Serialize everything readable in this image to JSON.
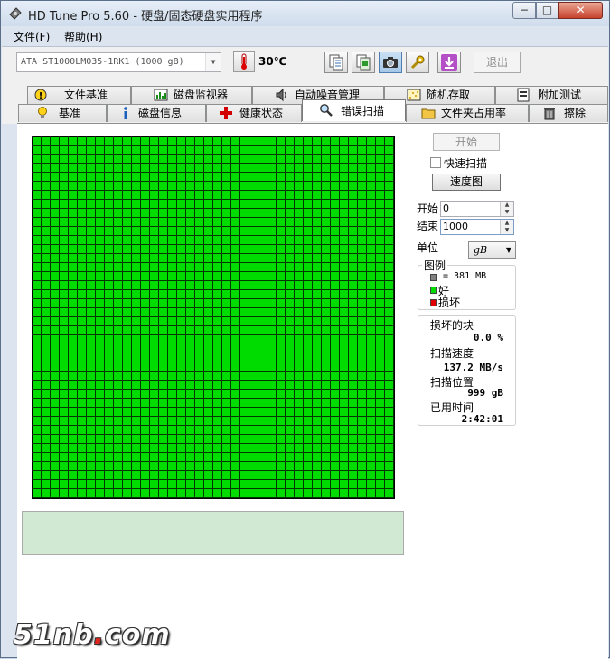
{
  "window": {
    "title": "HD Tune Pro 5.60 - 硬盘/固态硬盘实用程序",
    "minimize": "−",
    "maximize": "□",
    "close": "✕"
  },
  "menu": {
    "items": [
      "文件(F)",
      "帮助(H)"
    ]
  },
  "toolbar": {
    "drive": "ATA    ST1000LM035-1RK1  (1000 gB)",
    "temperature": "30℃",
    "exit_label": "退出"
  },
  "tabs": {
    "row1": [
      "文件基准",
      "磁盘监视器",
      "自动噪音管理",
      "随机存取",
      "附加测试"
    ],
    "row2": [
      "基准",
      "磁盘信息",
      "健康状态",
      "错误扫描",
      "文件夹占用率",
      "擦除"
    ],
    "active": "错误扫描"
  },
  "scan": {
    "start_button": "开始",
    "quick_scan_label": "快速扫描",
    "quick_scan_checked": false,
    "speed_map_button": "速度图",
    "start_label": "开始",
    "start_value": "0",
    "end_label": "结束",
    "end_value": "1000",
    "unit_label": "单位",
    "unit_value": "gB",
    "block_status": "all-good",
    "good_color": "#00dc00"
  },
  "legend": {
    "title": "图例",
    "block_size": "= 381 MB",
    "good": "好",
    "bad": "损坏",
    "block_color": "#808080",
    "good_color": "#00dc00",
    "bad_color": "#e00000"
  },
  "stats": {
    "damaged_label": "损坏的块",
    "damaged_value": "0.0 %",
    "speed_label": "扫描速度",
    "speed_value": "137.2 MB/s",
    "position_label": "扫描位置",
    "position_value": "999 gB",
    "elapsed_label": "已用时间",
    "elapsed_value": "2:42:01"
  },
  "watermark": {
    "text_a": "51nb",
    "dot": ".",
    "text_b": "com"
  }
}
